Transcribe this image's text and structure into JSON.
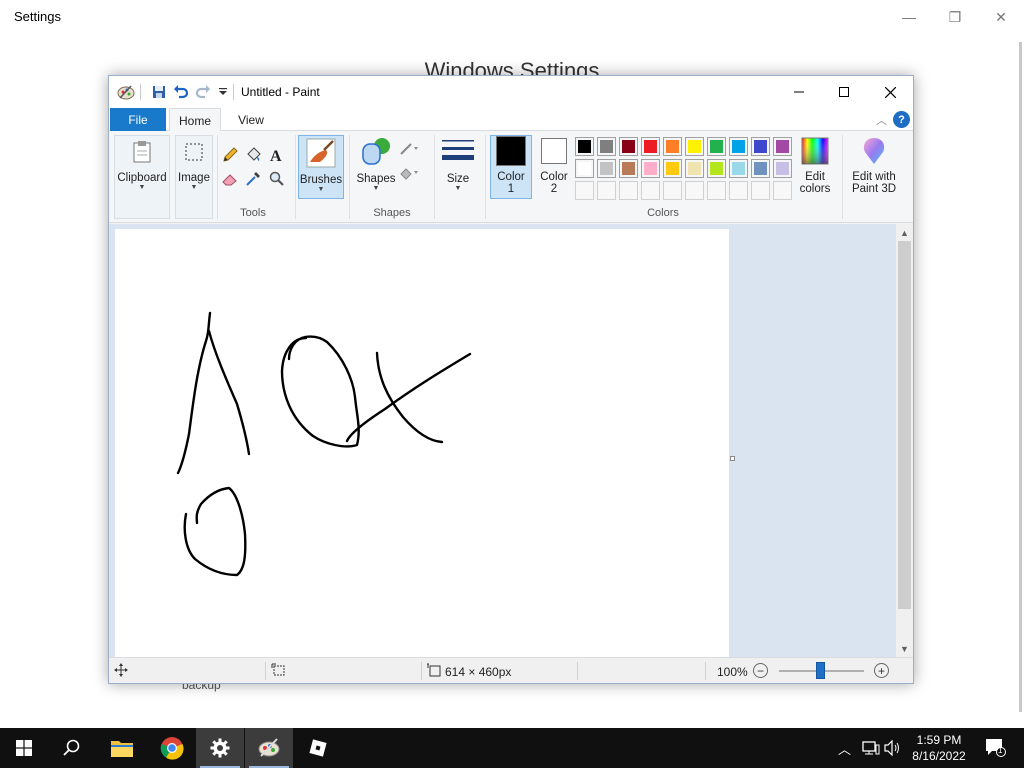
{
  "settings": {
    "title": "Settings",
    "heading": "Windows Settings",
    "partial_item": "backup"
  },
  "paint": {
    "window_title": "Untitled - Paint",
    "tabs": {
      "file": "File",
      "home": "Home",
      "view": "View"
    },
    "help": "?",
    "ribbon": {
      "clipboard": "Clipboard",
      "image": "Image",
      "tools_group": "Tools",
      "brushes": "Brushes",
      "shapes_btn": "Shapes",
      "shapes_group": "Shapes",
      "size": "Size",
      "color1_line1": "Color",
      "color1_line2": "1",
      "color2_line1": "Color",
      "color2_line2": "2",
      "colors_group": "Colors",
      "edit_colors_line1": "Edit",
      "edit_colors_line2": "colors",
      "paint3d_line1": "Edit with",
      "paint3d_line2": "Paint 3D",
      "color1_value": "#000000",
      "color2_value": "#ffffff",
      "palette_row1": [
        "#000000",
        "#7f7f7f",
        "#880015",
        "#ed1c24",
        "#ff7f27",
        "#fff200",
        "#22b14c",
        "#00a2e8",
        "#3f48cc",
        "#a349a4"
      ],
      "palette_row2": [
        "#ffffff",
        "#c3c3c3",
        "#b97a57",
        "#ffaec9",
        "#ffc90e",
        "#efe4b0",
        "#b5e61d",
        "#99d9ea",
        "#7092be",
        "#c8bfe7"
      ]
    },
    "status": {
      "canvas_size": "614 × 460px",
      "zoom": "100%"
    }
  },
  "taskbar": {
    "time": "1:59 PM",
    "date": "8/16/2022",
    "notification_count": "1"
  }
}
